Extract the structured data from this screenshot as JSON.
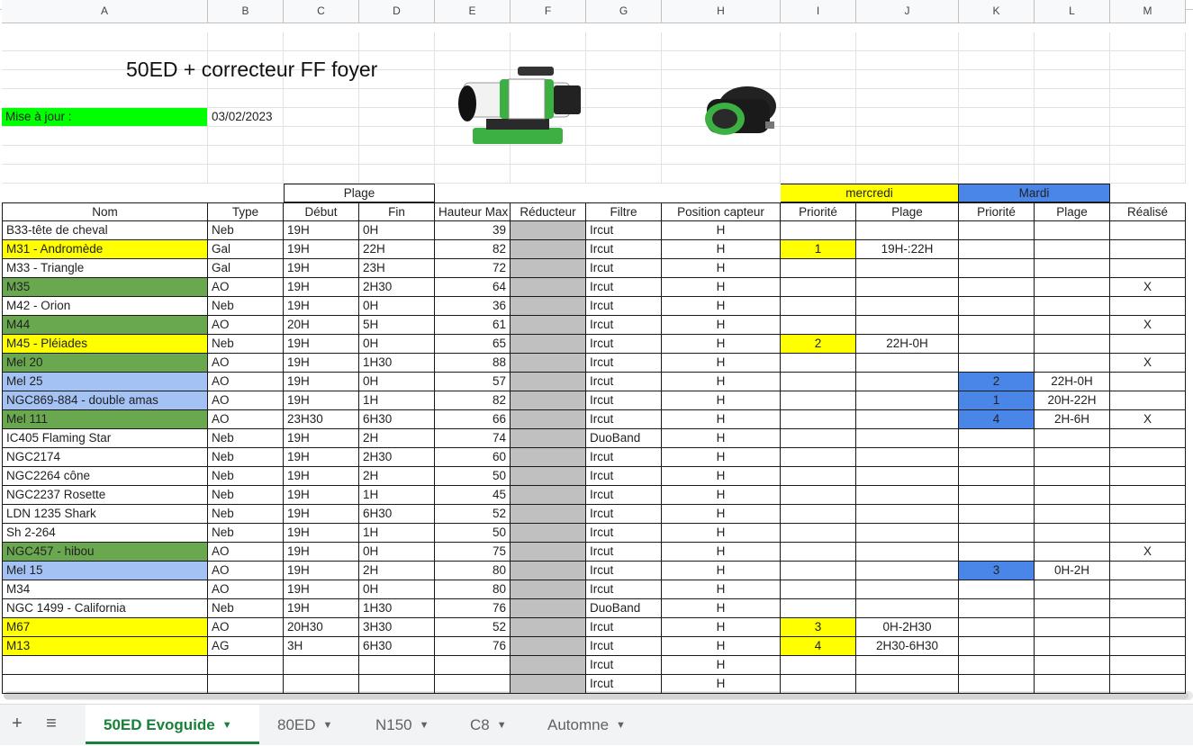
{
  "sheet": {
    "title": "50ED + correcteur FF foyer",
    "mise_a_jour_label": "Mise à jour :",
    "mise_a_jour_value": "03/02/2023",
    "col_letters": [
      "A",
      "B",
      "C",
      "D",
      "E",
      "F",
      "G",
      "H",
      "I",
      "J",
      "K",
      "L",
      "M"
    ],
    "group_headers": {
      "plage": "Plage",
      "mercredi": "mercredi",
      "mardi": "Mardi"
    },
    "headers": [
      "Nom",
      "Type",
      "Début",
      "Fin",
      "Hauteur Max",
      "Réducteur",
      "Filtre",
      "Position capteur",
      "Priorité",
      "Plage",
      "Priorité",
      "Plage",
      "Réalisé"
    ],
    "rows": [
      {
        "nom": "B33-tête de cheval",
        "type": "Neb",
        "debut": "19H",
        "fin": "0H",
        "hmax": "39",
        "filtre": "Ircut",
        "pos": "H",
        "p1": "",
        "pl1": "",
        "p2": "",
        "pl2": "",
        "real": "",
        "color": ""
      },
      {
        "nom": "M31 - Andromède",
        "type": "Gal",
        "debut": "19H",
        "fin": "22H",
        "hmax": "82",
        "filtre": "Ircut",
        "pos": "H",
        "p1": "1",
        "pl1": "19H-:22H",
        "p2": "",
        "pl2": "",
        "real": "",
        "color": "#ffff00"
      },
      {
        "nom": "M33 - Triangle",
        "type": "Gal",
        "debut": "19H",
        "fin": "23H",
        "hmax": "72",
        "filtre": "Ircut",
        "pos": "H",
        "p1": "",
        "pl1": "",
        "p2": "",
        "pl2": "",
        "real": "",
        "color": ""
      },
      {
        "nom": "M35",
        "type": "AO",
        "debut": "19H",
        "fin": "2H30",
        "hmax": "64",
        "filtre": "Ircut",
        "pos": "H",
        "p1": "",
        "pl1": "",
        "p2": "",
        "pl2": "",
        "real": "X",
        "color": "#6aa84f"
      },
      {
        "nom": "M42 - Orion",
        "type": "Neb",
        "debut": "19H",
        "fin": "0H",
        "hmax": "36",
        "filtre": "Ircut",
        "pos": "H",
        "p1": "",
        "pl1": "",
        "p2": "",
        "pl2": "",
        "real": "",
        "color": ""
      },
      {
        "nom": "M44",
        "type": "AO",
        "debut": "20H",
        "fin": "5H",
        "hmax": "61",
        "filtre": "Ircut",
        "pos": "H",
        "p1": "",
        "pl1": "",
        "p2": "",
        "pl2": "",
        "real": "X",
        "color": "#6aa84f"
      },
      {
        "nom": "M45 - Pléiades",
        "type": "Neb",
        "debut": "19H",
        "fin": "0H",
        "hmax": "65",
        "filtre": "Ircut",
        "pos": "H",
        "p1": "2",
        "pl1": "22H-0H",
        "p2": "",
        "pl2": "",
        "real": "",
        "color": "#ffff00"
      },
      {
        "nom": "Mel 20",
        "type": "AO",
        "debut": "19H",
        "fin": "1H30",
        "hmax": "88",
        "filtre": "Ircut",
        "pos": "H",
        "p1": "",
        "pl1": "",
        "p2": "",
        "pl2": "",
        "real": "X",
        "color": "#6aa84f"
      },
      {
        "nom": "Mel 25",
        "type": "AO",
        "debut": "19H",
        "fin": "0H",
        "hmax": "57",
        "filtre": "Ircut",
        "pos": "H",
        "p1": "",
        "pl1": "",
        "p2": "2",
        "pl2": "22H-0H",
        "real": "",
        "color": "#a4c2f4"
      },
      {
        "nom": "NGC869-884 - double amas",
        "type": "AO",
        "debut": "19H",
        "fin": "1H",
        "hmax": "82",
        "filtre": "Ircut",
        "pos": "H",
        "p1": "",
        "pl1": "",
        "p2": "1",
        "pl2": "20H-22H",
        "real": "",
        "color": "#a4c2f4"
      },
      {
        "nom": "Mel 111",
        "type": "AO",
        "debut": "23H30",
        "fin": "6H30",
        "hmax": "66",
        "filtre": "Ircut",
        "pos": "H",
        "p1": "",
        "pl1": "",
        "p2": "4",
        "pl2": "2H-6H",
        "real": "X",
        "color": "#6aa84f"
      },
      {
        "nom": "IC405 Flaming Star",
        "type": "Neb",
        "debut": "19H",
        "fin": "2H",
        "hmax": "74",
        "filtre": "DuoBand",
        "pos": "H",
        "p1": "",
        "pl1": "",
        "p2": "",
        "pl2": "",
        "real": "",
        "color": ""
      },
      {
        "nom": "NGC2174",
        "type": "Neb",
        "debut": "19H",
        "fin": "2H30",
        "hmax": "60",
        "filtre": "Ircut",
        "pos": "H",
        "p1": "",
        "pl1": "",
        "p2": "",
        "pl2": "",
        "real": "",
        "color": ""
      },
      {
        "nom": "NGC2264 cône",
        "type": "Neb",
        "debut": "19H",
        "fin": "2H",
        "hmax": "50",
        "filtre": "Ircut",
        "pos": "H",
        "p1": "",
        "pl1": "",
        "p2": "",
        "pl2": "",
        "real": "",
        "color": ""
      },
      {
        "nom": "NGC2237 Rosette",
        "type": "Neb",
        "debut": "19H",
        "fin": "1H",
        "hmax": "45",
        "filtre": "Ircut",
        "pos": "H",
        "p1": "",
        "pl1": "",
        "p2": "",
        "pl2": "",
        "real": "",
        "color": ""
      },
      {
        "nom": "LDN 1235 Shark",
        "type": "Neb",
        "debut": "19H",
        "fin": "6H30",
        "hmax": "52",
        "filtre": "Ircut",
        "pos": "H",
        "p1": "",
        "pl1": "",
        "p2": "",
        "pl2": "",
        "real": "",
        "color": ""
      },
      {
        "nom": "Sh 2-264",
        "type": "Neb",
        "debut": "19H",
        "fin": "1H",
        "hmax": "50",
        "filtre": "Ircut",
        "pos": "H",
        "p1": "",
        "pl1": "",
        "p2": "",
        "pl2": "",
        "real": "",
        "color": ""
      },
      {
        "nom": "NGC457 - hibou",
        "type": "AO",
        "debut": "19H",
        "fin": "0H",
        "hmax": "75",
        "filtre": "Ircut",
        "pos": "H",
        "p1": "",
        "pl1": "",
        "p2": "",
        "pl2": "",
        "real": "X",
        "color": "#6aa84f"
      },
      {
        "nom": "Mel 15",
        "type": "AO",
        "debut": "19H",
        "fin": "2H",
        "hmax": "80",
        "filtre": "Ircut",
        "pos": "H",
        "p1": "",
        "pl1": "",
        "p2": "3",
        "pl2": "0H-2H",
        "real": "",
        "color": "#a4c2f4"
      },
      {
        "nom": "M34",
        "type": "AO",
        "debut": "19H",
        "fin": "0H",
        "hmax": "80",
        "filtre": "Ircut",
        "pos": "H",
        "p1": "",
        "pl1": "",
        "p2": "",
        "pl2": "",
        "real": "",
        "color": ""
      },
      {
        "nom": "NGC 1499 - California",
        "type": "Neb",
        "debut": "19H",
        "fin": "1H30",
        "hmax": "76",
        "filtre": "DuoBand",
        "pos": "H",
        "p1": "",
        "pl1": "",
        "p2": "",
        "pl2": "",
        "real": "",
        "color": ""
      },
      {
        "nom": "M67",
        "type": "AO",
        "debut": "20H30",
        "fin": "3H30",
        "hmax": "52",
        "filtre": "Ircut",
        "pos": "H",
        "p1": "3",
        "pl1": "0H-2H30",
        "p2": "",
        "pl2": "",
        "real": "",
        "color": "#ffff00"
      },
      {
        "nom": "M13",
        "type": "AG",
        "debut": "3H",
        "fin": "6H30",
        "hmax": "76",
        "filtre": "Ircut",
        "pos": "H",
        "p1": "4",
        "pl1": "2H30-6H30",
        "p2": "",
        "pl2": "",
        "real": "",
        "color": "#ffff00"
      },
      {
        "nom": "",
        "type": "",
        "debut": "",
        "fin": "",
        "hmax": "",
        "filtre": "Ircut",
        "pos": "H",
        "p1": "",
        "pl1": "",
        "p2": "",
        "pl2": "",
        "real": "",
        "color": ""
      },
      {
        "nom": "",
        "type": "",
        "debut": "",
        "fin": "",
        "hmax": "",
        "filtre": "Ircut",
        "pos": "H",
        "p1": "",
        "pl1": "",
        "p2": "",
        "pl2": "",
        "real": "",
        "color": ""
      }
    ]
  },
  "tabs": [
    {
      "label": "50ED Evoguide",
      "active": true
    },
    {
      "label": "80ED",
      "active": false
    },
    {
      "label": "N150",
      "active": false
    },
    {
      "label": "C8",
      "active": false
    },
    {
      "label": "Automne",
      "active": false
    }
  ],
  "icons": {
    "add": "plus-icon",
    "list": "sheets-list-icon",
    "dropdown": "triangle-down-icon"
  },
  "colors": {
    "green_label": "#00ff00",
    "yellow": "#ffff00",
    "blue_header": "#4a86e8",
    "green_row": "#6aa84f",
    "light_blue_row": "#a4c2f4",
    "reducteur_gray": "#c0c0c0",
    "active_tab": "#188038"
  }
}
